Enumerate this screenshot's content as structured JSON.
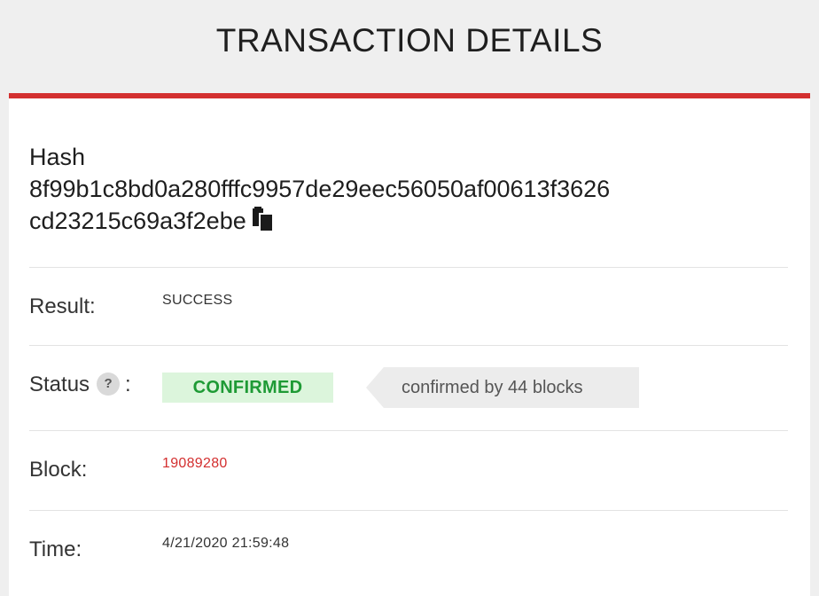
{
  "header": {
    "title": "TRANSACTION DETAILS"
  },
  "hash": {
    "label": "Hash",
    "line1": "8f99b1c8bd0a280fffc9957de29eec56050af00613f3626",
    "line2": "cd23215c69a3f2ebe",
    "copy_icon": "copy-icon"
  },
  "result": {
    "label": "Result:",
    "value": "SUCCESS"
  },
  "status": {
    "label": "Status",
    "help_icon_text": "?",
    "colon": ":",
    "badge": "CONFIRMED",
    "badge_color": "#1e9a35",
    "tooltip": "confirmed by 44 blocks"
  },
  "block": {
    "label": "Block:",
    "value": "19089280",
    "value_color": "#d32f2f"
  },
  "time": {
    "label": "Time:",
    "value": "4/21/2020 21:59:48"
  },
  "colors": {
    "accent": "#d32f2f",
    "background": "#efefef"
  }
}
